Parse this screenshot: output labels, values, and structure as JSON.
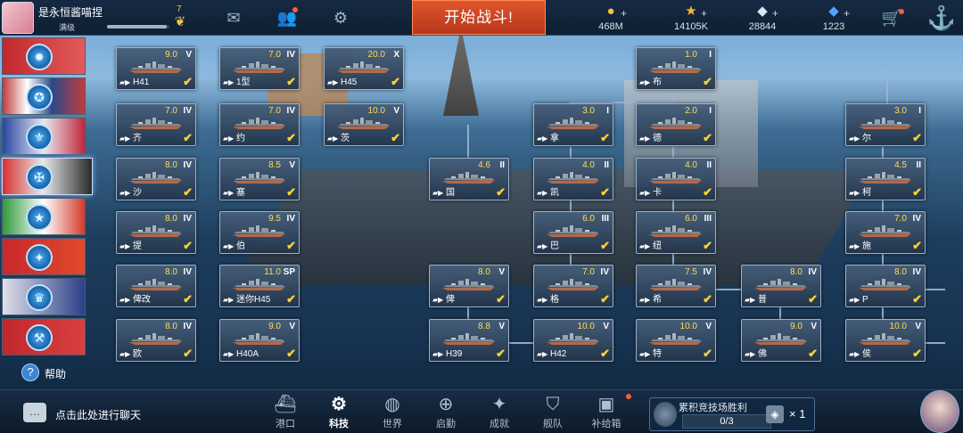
{
  "player": {
    "name": "是永恒酱喵捏",
    "level": "满级",
    "rank": "7",
    "xp_fraction": 0.95
  },
  "header": {
    "start_battle": "开始战斗!"
  },
  "currencies": [
    {
      "icon": "gold-coin-icon",
      "glyph": "●",
      "color": "#f3c23b",
      "value": "468M"
    },
    {
      "icon": "star-icon",
      "glyph": "★",
      "color": "#f4b637",
      "value": "14105K"
    },
    {
      "icon": "diamond-icon",
      "glyph": "◆",
      "color": "#d8e6f5",
      "value": "28844"
    },
    {
      "icon": "blue-gem-icon",
      "glyph": "◆",
      "color": "#4fa4ff",
      "value": "1223"
    }
  ],
  "help": {
    "label": "帮助"
  },
  "chat": {
    "label": "点击此处进行聊天"
  },
  "nav": [
    {
      "label": "港口",
      "icon": "harbor-icon",
      "glyph": "⛴"
    },
    {
      "label": "科技",
      "icon": "tech-icon",
      "glyph": "⚙",
      "active": true
    },
    {
      "label": "世界",
      "icon": "globe-icon",
      "glyph": "◍"
    },
    {
      "label": "启勤",
      "icon": "dispatch-icon",
      "glyph": "⊕"
    },
    {
      "label": "成就",
      "icon": "achievement-icon",
      "glyph": "✦"
    },
    {
      "label": "舰队",
      "icon": "fleet-icon",
      "glyph": "⛉"
    },
    {
      "label": "补给箱",
      "icon": "supply-box-icon",
      "glyph": "▣"
    }
  ],
  "arena": {
    "label": "累积竞技场胜利",
    "progress": "0/3",
    "reward_count": "× 1"
  },
  "ships": [
    {
      "id": "h41",
      "name": "H41",
      "tier": "9.0",
      "class": "V"
    },
    {
      "id": "type1",
      "name": "1型",
      "tier": "7.0",
      "class": "IV"
    },
    {
      "id": "h45",
      "name": "H45",
      "tier": "20.0",
      "class": "X"
    },
    {
      "id": "qi",
      "name": "齐",
      "tier": "7.0",
      "class": "IV"
    },
    {
      "id": "yue",
      "name": "约",
      "tier": "7.0",
      "class": "IV"
    },
    {
      "id": "ci",
      "name": "茨",
      "tier": "10.0",
      "class": "V"
    },
    {
      "id": "sha",
      "name": "沙",
      "tier": "8.0",
      "class": "IV"
    },
    {
      "id": "sai",
      "name": "塞",
      "tier": "8.5",
      "class": "V"
    },
    {
      "id": "ti",
      "name": "提",
      "tier": "8.0",
      "class": "IV"
    },
    {
      "id": "bo",
      "name": "伯",
      "tier": "9.5",
      "class": "IV"
    },
    {
      "id": "beigai",
      "name": "俾改",
      "tier": "8.0",
      "class": "IV"
    },
    {
      "id": "minih45",
      "name": "迷你H45",
      "tier": "11.0",
      "class": "SP"
    },
    {
      "id": "ou",
      "name": "欧",
      "tier": "8.0",
      "class": "IV"
    },
    {
      "id": "h40a",
      "name": "H40A",
      "tier": "9.0",
      "class": "V"
    },
    {
      "id": "bu",
      "name": "布",
      "tier": "1.0",
      "class": "I"
    },
    {
      "id": "na",
      "name": "拿",
      "tier": "3.0",
      "class": "I"
    },
    {
      "id": "de",
      "name": "德",
      "tier": "2.0",
      "class": "I"
    },
    {
      "id": "er",
      "name": "尔",
      "tier": "3.0",
      "class": "I"
    },
    {
      "id": "guo",
      "name": "国",
      "tier": "4.6",
      "class": "II"
    },
    {
      "id": "kai",
      "name": "凯",
      "tier": "4.0",
      "class": "II"
    },
    {
      "id": "ka",
      "name": "卡",
      "tier": "4.0",
      "class": "II"
    },
    {
      "id": "ke",
      "name": "柯",
      "tier": "4.5",
      "class": "II"
    },
    {
      "id": "ba",
      "name": "巴",
      "tier": "6.0",
      "class": "III"
    },
    {
      "id": "niu",
      "name": "纽",
      "tier": "6.0",
      "class": "III"
    },
    {
      "id": "shi",
      "name": "施",
      "tier": "7.0",
      "class": "IV"
    },
    {
      "id": "bi",
      "name": "俾",
      "tier": "8.0",
      "class": "V"
    },
    {
      "id": "ge",
      "name": "格",
      "tier": "7.0",
      "class": "IV"
    },
    {
      "id": "xi",
      "name": "希",
      "tier": "7.5",
      "class": "IV"
    },
    {
      "id": "pu",
      "name": "普",
      "tier": "8.0",
      "class": "IV"
    },
    {
      "id": "p",
      "name": "P",
      "tier": "8.0",
      "class": "IV"
    },
    {
      "id": "h39",
      "name": "H39",
      "tier": "8.8",
      "class": "V"
    },
    {
      "id": "h42",
      "name": "H42",
      "tier": "10.0",
      "class": "V"
    },
    {
      "id": "te",
      "name": "特",
      "tier": "10.0",
      "class": "V"
    },
    {
      "id": "fo",
      "name": "佛",
      "tier": "9.0",
      "class": "V"
    },
    {
      "id": "hou",
      "name": "侯",
      "tier": "10.0",
      "class": "V"
    }
  ]
}
